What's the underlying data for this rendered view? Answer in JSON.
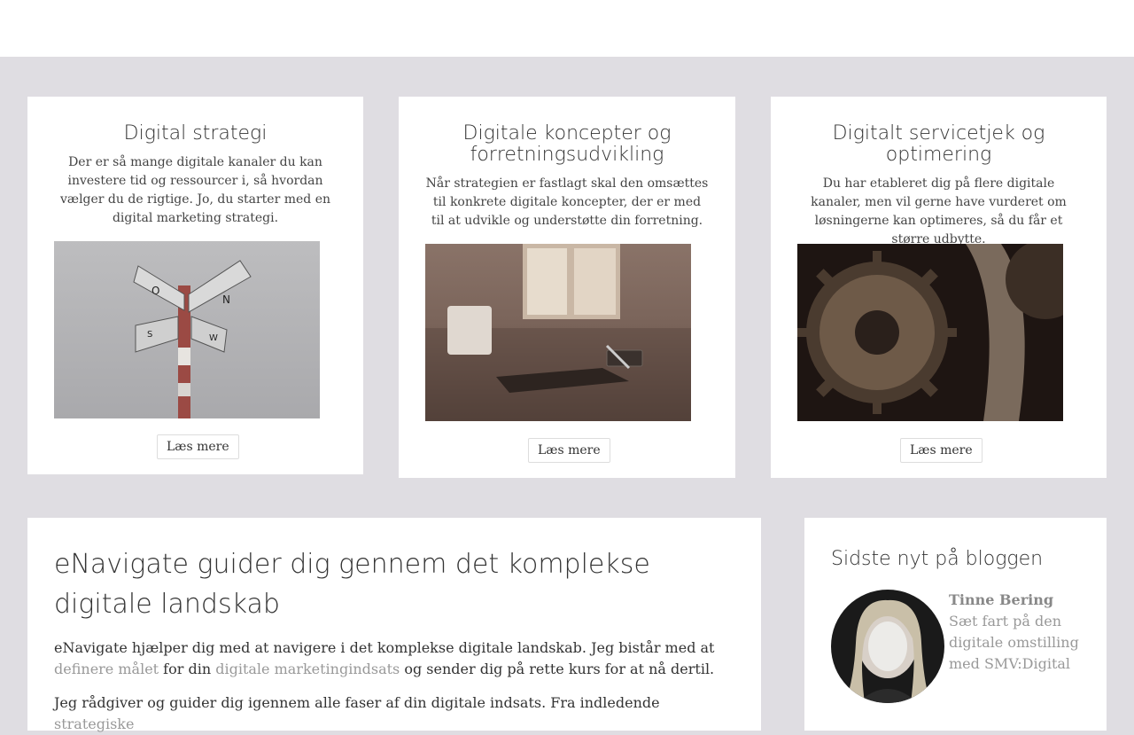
{
  "cards": [
    {
      "title": "Digital strategi",
      "description": "Der er så mange digitale kanaler du kan investere tid og ressourcer i, så hvordan vælger du de rigtige. Jo, du starter med en digital marketing strategi.",
      "button": "Læs mere",
      "image_icon": "signpost-image"
    },
    {
      "title": "Digitale koncepter og forretningsudvikling",
      "description": "Når strategien er fastlagt skal den omsættes til konkrete digitale koncepter, der er med til at udvikle og understøtte din forretning.",
      "button": "Læs mere",
      "image_icon": "desk-image"
    },
    {
      "title": "Digitalt servicetjek og optimering",
      "description": "Du har etableret dig på flere digitale kanaler, men vil gerne have vurderet om løsningerne kan optimeres, så du får et større udbytte.",
      "button": "Læs mere",
      "image_icon": "gears-image"
    }
  ],
  "main": {
    "heading": "eNavigate guider dig gennem det komplekse digitale landskab",
    "p1_a": "eNavigate hjælper dig med at navigere i det komplekse digitale landskab. Jeg bistår med at ",
    "p1_link1": "definere målet",
    "p1_b": " for din ",
    "p1_link2": "digitale marketingindsats",
    "p1_c": " og sender dig på rette kurs for at nå dertil.",
    "p2_a": "Jeg rådgiver og guider dig igennem alle faser af din digitale indsats. Fra indledende ",
    "p2_link1": "strategiske"
  },
  "sidebar": {
    "heading": "Sidste nyt på bloggen",
    "author": "Tinne Bering",
    "post_title": "Sæt fart på den digitale omstilling med SMV:Digital"
  },
  "colors": {
    "background": "#dfdde2",
    "link": "#999999"
  }
}
